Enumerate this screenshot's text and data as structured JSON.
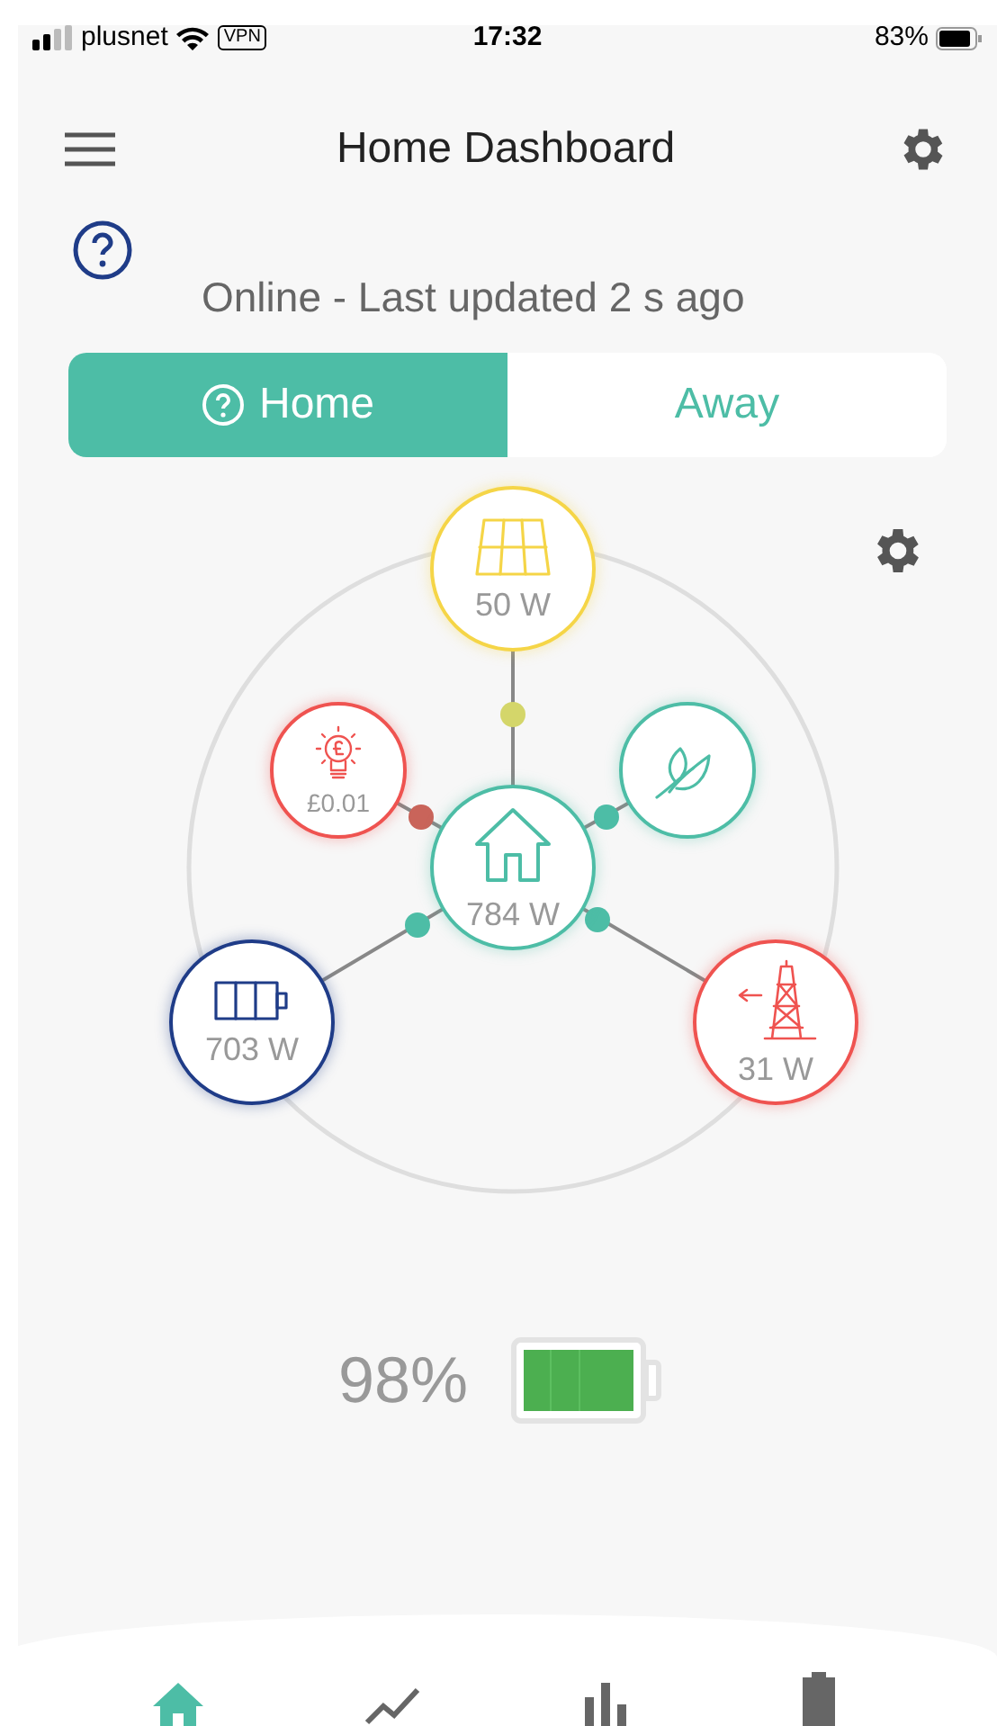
{
  "status_bar": {
    "carrier": "plusnet",
    "vpn": "VPN",
    "time": "17:32",
    "battery": "83%"
  },
  "header": {
    "title": "Home Dashboard"
  },
  "connection": {
    "status": "Online - Last updated 2 s ago"
  },
  "mode_tabs": [
    {
      "label": "Home",
      "selected": true
    },
    {
      "label": "Away",
      "selected": false
    }
  ],
  "nodes": [
    {
      "kind": "solar",
      "value": "50 W",
      "color": "#f5d547"
    },
    {
      "kind": "tariff",
      "value": "£0.01",
      "color": "#ef5350"
    },
    {
      "kind": "eco",
      "color": "#4dbda6"
    },
    {
      "kind": "home",
      "value": "784 W",
      "color": "#4dbda6"
    },
    {
      "kind": "battery",
      "value": "703 W",
      "color": "#1f3c88"
    },
    {
      "kind": "grid",
      "value": "31 W",
      "color": "#ef5350"
    }
  ],
  "battery": {
    "percent": "98%"
  },
  "nav": [
    {
      "kind": "home",
      "selected": true
    },
    {
      "kind": "trend",
      "selected": false
    },
    {
      "kind": "stats",
      "selected": false
    },
    {
      "kind": "battery",
      "selected": false
    }
  ]
}
